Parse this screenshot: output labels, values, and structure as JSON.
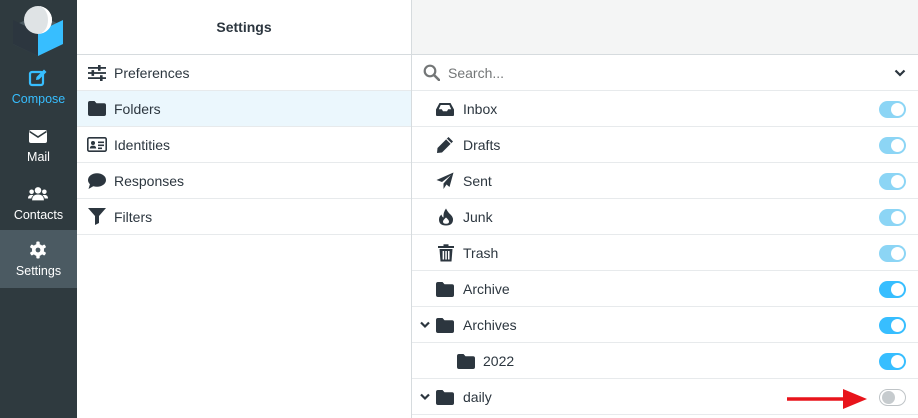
{
  "nav": {
    "compose": "Compose",
    "mail": "Mail",
    "contacts": "Contacts",
    "settings": "Settings"
  },
  "settings_panel": {
    "title": "Settings",
    "items": [
      {
        "label": "Preferences",
        "icon": "sliders-icon"
      },
      {
        "label": "Folders",
        "icon": "folder-icon",
        "selected": true
      },
      {
        "label": "Identities",
        "icon": "id-card-icon"
      },
      {
        "label": "Responses",
        "icon": "comment-icon"
      },
      {
        "label": "Filters",
        "icon": "filter-icon"
      }
    ]
  },
  "folders_panel": {
    "search_placeholder": "Search...",
    "folders": [
      {
        "name": "Inbox",
        "icon": "inbox-icon",
        "subscribed": true,
        "locked": true
      },
      {
        "name": "Drafts",
        "icon": "pencil-icon",
        "subscribed": true,
        "locked": true
      },
      {
        "name": "Sent",
        "icon": "paper-plane-icon",
        "subscribed": true,
        "locked": true
      },
      {
        "name": "Junk",
        "icon": "fire-icon",
        "subscribed": true,
        "locked": true
      },
      {
        "name": "Trash",
        "icon": "trash-icon",
        "subscribed": true,
        "locked": true
      },
      {
        "name": "Archive",
        "icon": "folder-icon",
        "subscribed": true,
        "locked": false
      },
      {
        "name": "Archives",
        "icon": "folder-icon",
        "subscribed": true,
        "expanded": true
      },
      {
        "name": "2022",
        "icon": "folder-icon",
        "subscribed": true,
        "child": true
      },
      {
        "name": "daily",
        "icon": "folder-icon",
        "subscribed": false,
        "expanded": true
      }
    ]
  },
  "colors": {
    "accent": "#37beff",
    "rail": "#2f3a3f",
    "selected_row": "#ebf7fd",
    "annotation_arrow": "#e8141b"
  }
}
